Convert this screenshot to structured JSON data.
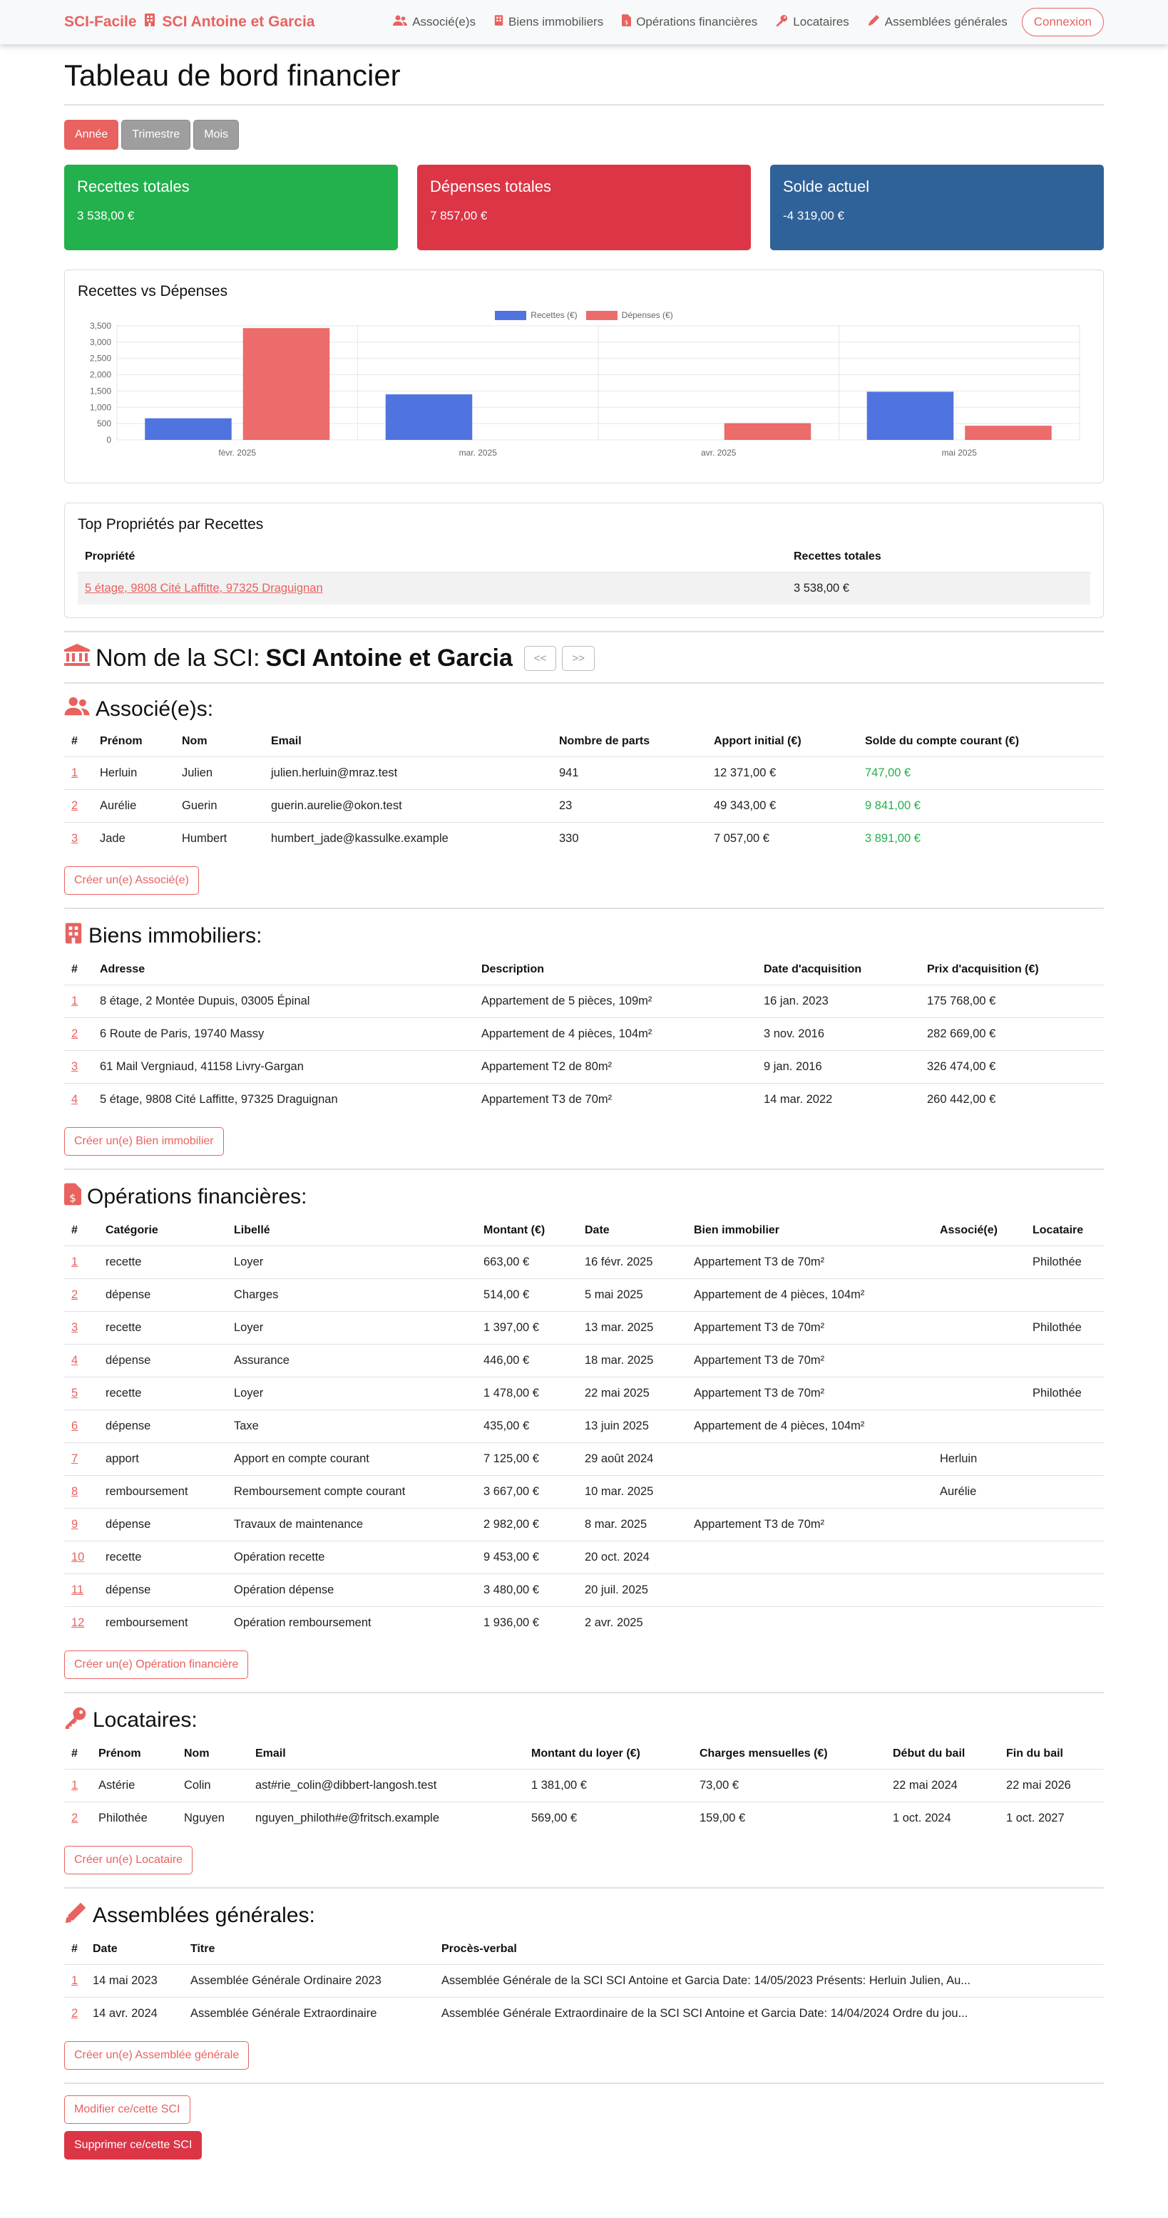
{
  "navbar": {
    "app_name": "SCI-Facile",
    "sci_name": "SCI Antoine et Garcia",
    "links": [
      "Associé(e)s",
      "Biens immobiliers",
      "Opérations financières",
      "Locataires",
      "Assemblées générales"
    ],
    "login": "Connexion"
  },
  "dashboard": {
    "title": "Tableau de bord financier",
    "periods": [
      "Année",
      "Trimestre",
      "Mois"
    ],
    "cards": [
      {
        "label": "Recettes totales",
        "value": "3 538,00 €",
        "color": "#22b14c"
      },
      {
        "label": "Dépenses totales",
        "value": "7 857,00 €",
        "color": "#dc3545"
      },
      {
        "label": "Solde actuel",
        "value": "-4 319,00 €",
        "color": "#2f6298"
      }
    ],
    "chart_title": "Recettes vs Dépenses",
    "top_title": "Top Propriétés par Recettes",
    "top_headers": [
      "Propriété",
      "Recettes totales"
    ],
    "top_rows": [
      [
        "5 étage, 9808 Cité Laffitte, 97325 Draguignan",
        "3 538,00 €"
      ]
    ]
  },
  "chart_data": {
    "type": "bar",
    "categories": [
      "févr. 2025",
      "mar. 2025",
      "avr. 2025",
      "mai 2025"
    ],
    "series": [
      {
        "name": "Recettes (€)",
        "values": [
          663,
          1397,
          0,
          1478
        ],
        "color": "#4f73df"
      },
      {
        "name": "Dépenses (€)",
        "values": [
          3430,
          0,
          514,
          435
        ],
        "color": "#ec6b6b"
      }
    ],
    "yticks": [
      "0",
      "500",
      "1,000",
      "1,500",
      "2,000",
      "2,500",
      "3,000",
      "3,500"
    ],
    "ylim": [
      0,
      3500
    ],
    "grid": true,
    "legend": "top-center"
  },
  "sci": {
    "title_prefix": "Nom de la SCI:",
    "title_name": "SCI Antoine et Garcia",
    "prev": "<<",
    "next": ">>"
  },
  "associes": {
    "title": "Associé(e)s:",
    "headers": [
      "#",
      "Prénom",
      "Nom",
      "Email",
      "Nombre de parts",
      "Apport initial (€)",
      "Solde du compte courant (€)"
    ],
    "rows": [
      [
        "1",
        "Herluin",
        "Julien",
        "julien.herluin@mraz.test",
        "941",
        "12 371,00 €",
        "747,00 €"
      ],
      [
        "2",
        "Aurélie",
        "Guerin",
        "guerin.aurelie@okon.test",
        "23",
        "49 343,00 €",
        "9 841,00 €"
      ],
      [
        "3",
        "Jade",
        "Humbert",
        "humbert_jade@kassulke.example",
        "330",
        "7 057,00 €",
        "3 891,00 €"
      ]
    ],
    "create": "Créer un(e) Associé(e)"
  },
  "biens": {
    "title": "Biens immobiliers:",
    "headers": [
      "#",
      "Adresse",
      "Description",
      "Date d'acquisition",
      "Prix d'acquisition (€)"
    ],
    "rows": [
      [
        "1",
        "8 étage, 2 Montée Dupuis, 03005 Épinal",
        "Appartement de 5 pièces, 109m²",
        "16 jan. 2023",
        "175 768,00 €"
      ],
      [
        "2",
        "6 Route de Paris, 19740 Massy",
        "Appartement de 4 pièces, 104m²",
        "3 nov. 2016",
        "282 669,00 €"
      ],
      [
        "3",
        "61 Mail Vergniaud, 41158 Livry-Gargan",
        "Appartement T2 de 80m²",
        "9 jan. 2016",
        "326 474,00 €"
      ],
      [
        "4",
        "5 étage, 9808 Cité Laffitte, 97325 Draguignan",
        "Appartement T3 de 70m²",
        "14 mar. 2022",
        "260 442,00 €"
      ]
    ],
    "create": "Créer un(e) Bien immobilier"
  },
  "operations": {
    "title": "Opérations financières:",
    "headers": [
      "#",
      "Catégorie",
      "Libellé",
      "Montant (€)",
      "Date",
      "Bien immobilier",
      "Associé(e)",
      "Locataire"
    ],
    "rows": [
      [
        "1",
        "recette",
        "Loyer",
        "663,00 €",
        "16 févr. 2025",
        "Appartement T3 de 70m²",
        "",
        "Philothée"
      ],
      [
        "2",
        "dépense",
        "Charges",
        "514,00 €",
        "5 mai 2025",
        "Appartement de 4 pièces, 104m²",
        "",
        ""
      ],
      [
        "3",
        "recette",
        "Loyer",
        "1 397,00 €",
        "13 mar. 2025",
        "Appartement T3 de 70m²",
        "",
        "Philothée"
      ],
      [
        "4",
        "dépense",
        "Assurance",
        "446,00 €",
        "18 mar. 2025",
        "Appartement T3 de 70m²",
        "",
        ""
      ],
      [
        "5",
        "recette",
        "Loyer",
        "1 478,00 €",
        "22 mai 2025",
        "Appartement T3 de 70m²",
        "",
        "Philothée"
      ],
      [
        "6",
        "dépense",
        "Taxe",
        "435,00 €",
        "13 juin 2025",
        "Appartement de 4 pièces, 104m²",
        "",
        ""
      ],
      [
        "7",
        "apport",
        "Apport en compte courant",
        "7 125,00 €",
        "29 août 2024",
        "",
        "Herluin",
        ""
      ],
      [
        "8",
        "remboursement",
        "Remboursement compte courant",
        "3 667,00 €",
        "10 mar. 2025",
        "",
        "Aurélie",
        ""
      ],
      [
        "9",
        "dépense",
        "Travaux de maintenance",
        "2 982,00 €",
        "8 mar. 2025",
        "Appartement T3 de 70m²",
        "",
        ""
      ],
      [
        "10",
        "recette",
        "Opération recette",
        "9 453,00 €",
        "20 oct. 2024",
        "",
        "",
        ""
      ],
      [
        "11",
        "dépense",
        "Opération dépense",
        "3 480,00 €",
        "20 juil. 2025",
        "",
        "",
        ""
      ],
      [
        "12",
        "remboursement",
        "Opération remboursement",
        "1 936,00 €",
        "2 avr. 2025",
        "",
        "",
        ""
      ]
    ],
    "create": "Créer un(e) Opération financière"
  },
  "locataires": {
    "title": "Locataires:",
    "headers": [
      "#",
      "Prénom",
      "Nom",
      "Email",
      "Montant du loyer (€)",
      "Charges mensuelles (€)",
      "Début du bail",
      "Fin du bail"
    ],
    "rows": [
      [
        "1",
        "Astérie",
        "Colin",
        "ast#rie_colin@dibbert-langosh.test",
        "1 381,00 €",
        "73,00 €",
        "22 mai 2024",
        "22 mai 2026"
      ],
      [
        "2",
        "Philothée",
        "Nguyen",
        "nguyen_philoth#e@fritsch.example",
        "569,00 €",
        "159,00 €",
        "1 oct. 2024",
        "1 oct. 2027"
      ]
    ],
    "create": "Créer un(e) Locataire"
  },
  "assemblees": {
    "title": "Assemblées générales:",
    "headers": [
      "#",
      "Date",
      "Titre",
      "Procès-verbal"
    ],
    "rows": [
      [
        "1",
        "14 mai 2023",
        "Assemblée Générale Ordinaire 2023",
        "Assemblée Générale de la SCI SCI Antoine et Garcia Date: 14/05/2023 Présents: Herluin Julien, Au..."
      ],
      [
        "2",
        "14 avr. 2024",
        "Assemblée Générale Extraordinaire",
        "Assemblée Générale Extraordinaire de la SCI SCI Antoine et Garcia Date: 14/04/2024 Ordre du jou..."
      ]
    ],
    "create": "Créer un(e) Assemblée générale"
  },
  "footer_actions": {
    "edit": "Modifier ce/cette SCI",
    "delete": "Supprimer ce/cette SCI"
  }
}
